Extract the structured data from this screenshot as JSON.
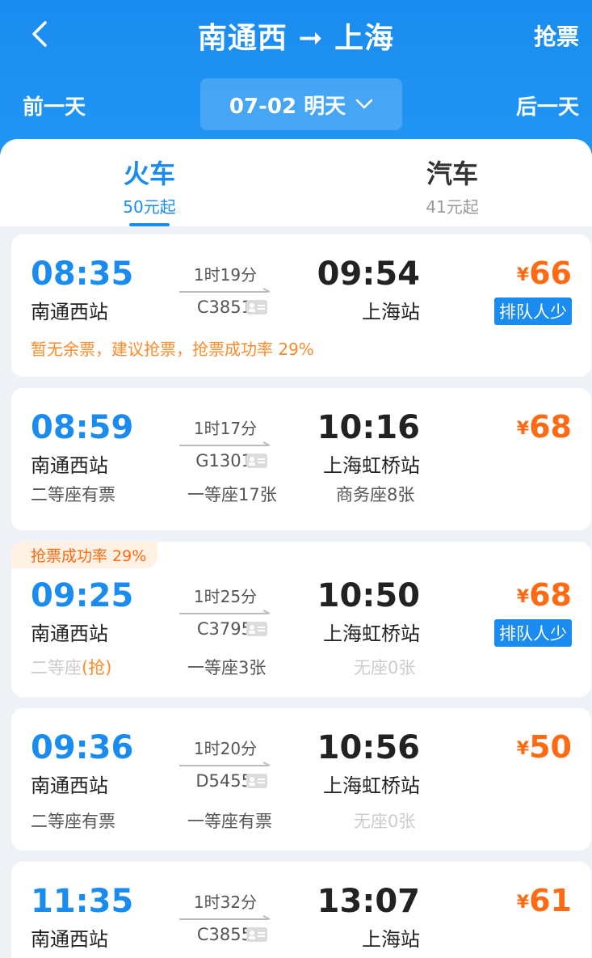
{
  "header": {
    "title": "南通西 ➞ 上海",
    "grab_label": "抢票",
    "prev_day": "前一天",
    "next_day": "后一天",
    "date": "07-02 明天"
  },
  "tabs": [
    {
      "label": "火车",
      "sub": "50元起"
    },
    {
      "label": "汽车",
      "sub": "41元起"
    }
  ],
  "trains": [
    {
      "dep_time": "08:35",
      "dep_station": "南通西站",
      "duration": "1时19分",
      "train_no": "C3851",
      "arr_time": "09:54",
      "arr_station": "上海站",
      "price": "66",
      "queue": "排队人少",
      "warning": "暂无余票，建议抢票，抢票成功率 29%"
    },
    {
      "dep_time": "08:59",
      "dep_station": "南通西站",
      "duration": "1时17分",
      "train_no": "G1301",
      "arr_time": "10:16",
      "arr_station": "上海虹桥站",
      "price": "68",
      "seat_a": "二等座有票",
      "seat_b": "一等座17张",
      "seat_c": "商务座8张"
    },
    {
      "ribbon": "抢票成功率 29%",
      "dep_time": "09:25",
      "dep_station": "南通西站",
      "duration": "1时25分",
      "train_no": "C3795",
      "arr_time": "10:50",
      "arr_station": "上海虹桥站",
      "price": "68",
      "queue": "排队人少",
      "seat_a": "二等座",
      "seat_a_grab": "(抢)",
      "seat_b": "一等座3张",
      "seat_c": "无座0张"
    },
    {
      "dep_time": "09:36",
      "dep_station": "南通西站",
      "duration": "1时20分",
      "train_no": "D5455",
      "arr_time": "10:56",
      "arr_station": "上海虹桥站",
      "price": "50",
      "seat_a": "二等座有票",
      "seat_b": "一等座有票",
      "seat_c": "无座0张"
    },
    {
      "dep_time": "11:35",
      "dep_station": "南通西站",
      "duration": "1时32分",
      "train_no": "C3855",
      "arr_time": "13:07",
      "arr_station": "上海站",
      "price": "61"
    }
  ],
  "currency": "¥",
  "colors": {
    "primary": "#1a8cf0",
    "price": "#ff6a13",
    "warning": "#ff8a2a"
  }
}
